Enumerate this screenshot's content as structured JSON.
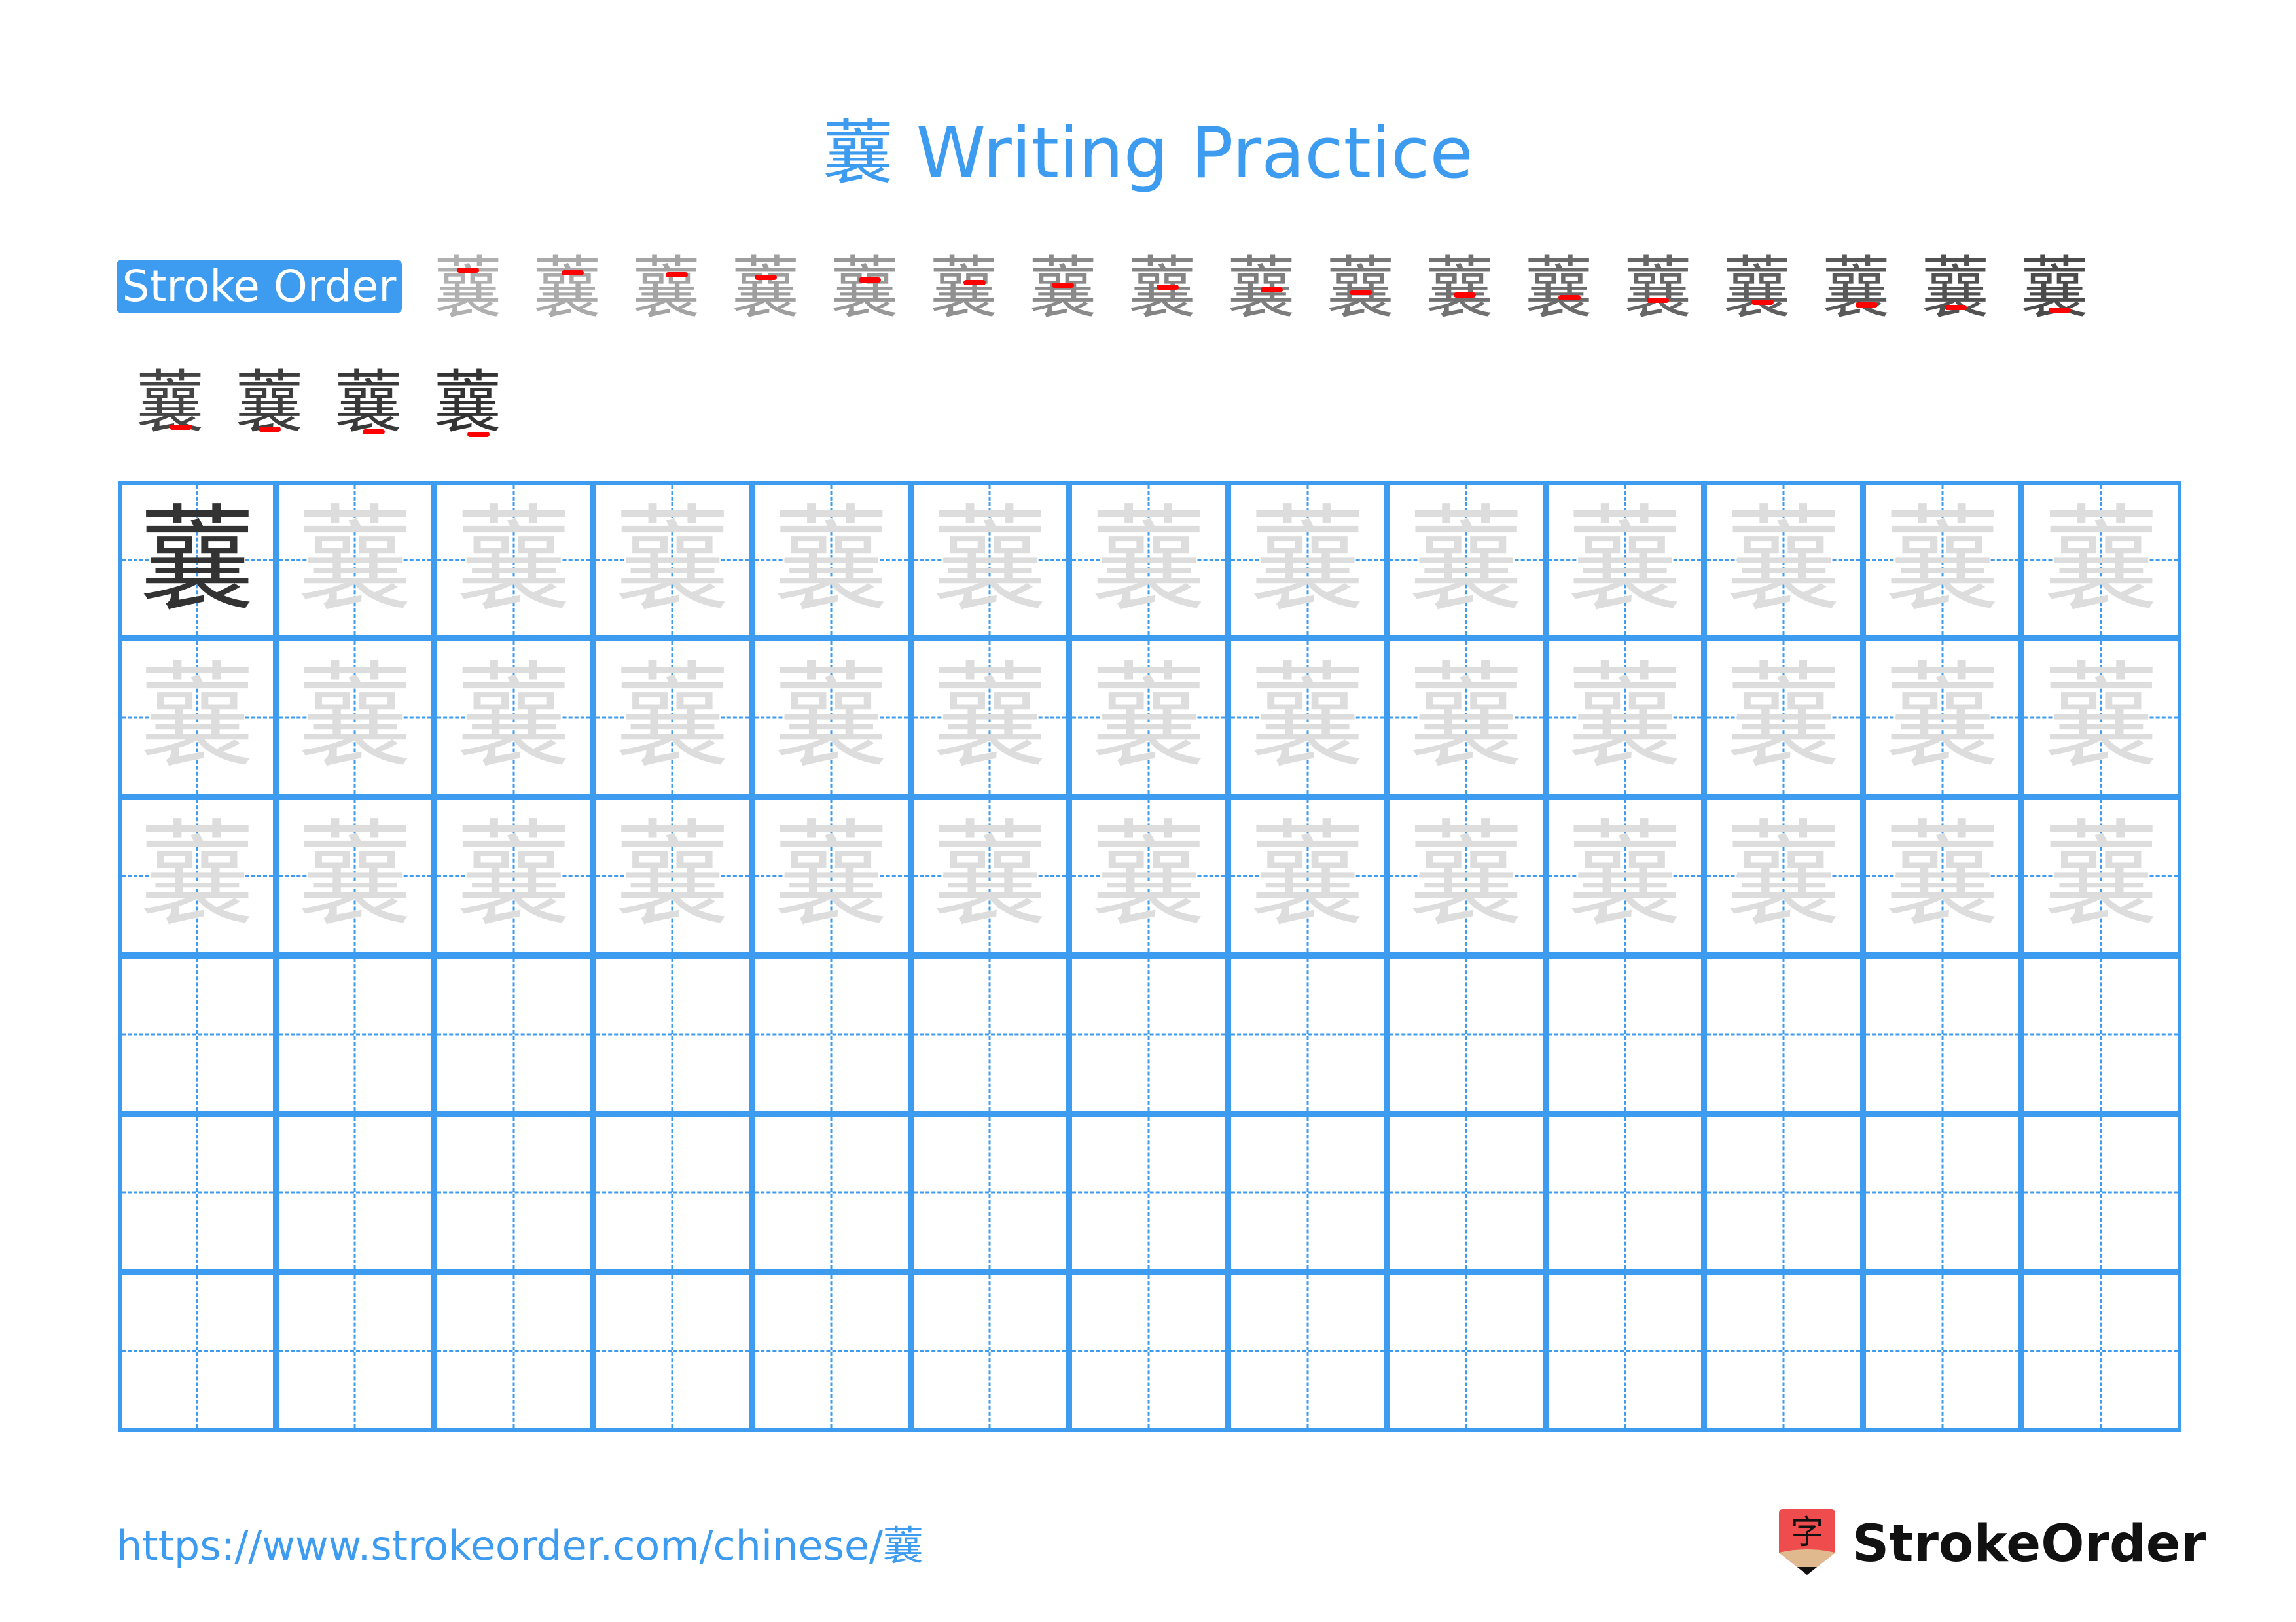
{
  "page": {
    "character": "蘘",
    "title": "蘘 Writing Practice",
    "stroke_order_label": "Stroke Order",
    "stroke_count": 21,
    "url": "https://www.strokeorder.com/chinese/蘘",
    "brand": "StrokeOrder",
    "brand_icon_glyph": "字"
  },
  "colors": {
    "accent": "#3d9bf0",
    "model_glyph": "#333333",
    "trace_glyph": "#dddddd",
    "stroke_highlight": "#ff0000",
    "logo_red": "#ef4d4d",
    "logo_wood": "#e0b98f"
  },
  "stroke_steps": [
    {
      "step": 1
    },
    {
      "step": 2
    },
    {
      "step": 3
    },
    {
      "step": 4
    },
    {
      "step": 5
    },
    {
      "step": 6
    },
    {
      "step": 7
    },
    {
      "step": 8
    },
    {
      "step": 9
    },
    {
      "step": 10
    },
    {
      "step": 11
    },
    {
      "step": 12
    },
    {
      "step": 13
    },
    {
      "step": 14
    },
    {
      "step": 15
    },
    {
      "step": 16
    },
    {
      "step": 17
    },
    {
      "step": 18
    },
    {
      "step": 19
    },
    {
      "step": 20
    },
    {
      "step": 21
    }
  ],
  "grid": {
    "rows": 6,
    "cols": 13,
    "row_types": [
      "model-then-trace",
      "trace",
      "trace",
      "empty",
      "empty",
      "empty"
    ]
  }
}
